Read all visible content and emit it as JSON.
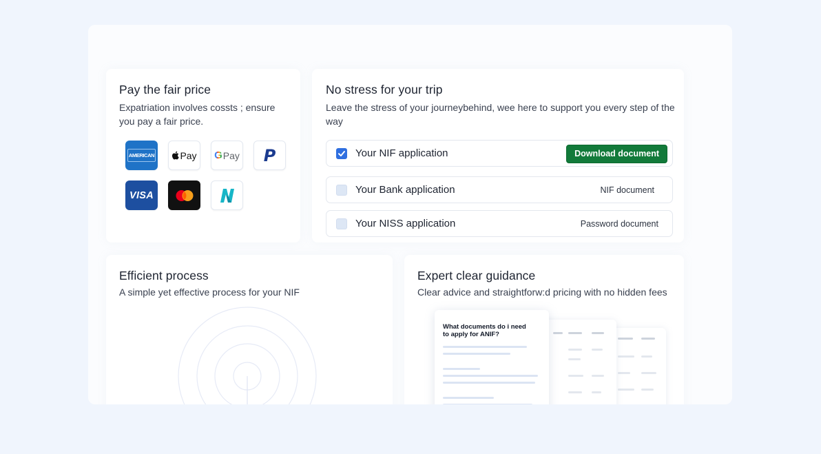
{
  "pay_card": {
    "title": "Pay the fair price",
    "desc_line1": "Expatriation involves cossts ; ensure",
    "desc_line2": "you pay a fair price.",
    "methods": {
      "amex": "AMERICAN",
      "apple_pay": "Pay",
      "google_pay": "Pay",
      "paypal": "P",
      "visa": "VISA"
    }
  },
  "trip_card": {
    "title": "No stress for your trip",
    "desc_line1": "Leave the stress of your journeybehind, wee here to support you every step of the",
    "desc_line2": "way",
    "applications": [
      {
        "label": "Your NIF application",
        "checked": true,
        "action": "Download document"
      },
      {
        "label": "Your Bank application",
        "checked": false,
        "action": "NIF document"
      },
      {
        "label": "Your NISS application",
        "checked": false,
        "action": "Password document"
      }
    ]
  },
  "efficient_card": {
    "title": "Efficient process",
    "desc": "A simple yet effective process for your NIF"
  },
  "guidance_card": {
    "title": "Expert clear guidance",
    "desc": "Clear advice and straightforw:d pricing with no hidden fees",
    "doc_question_line1": "What documents do i need",
    "doc_question_line2": "to apply for ANIF?"
  },
  "colors": {
    "page_bg": "#f0f5fd",
    "download_button": "#127a3a",
    "checkbox_checked": "#2f6fe0",
    "checkbox_unchecked": "#dde7f5"
  }
}
